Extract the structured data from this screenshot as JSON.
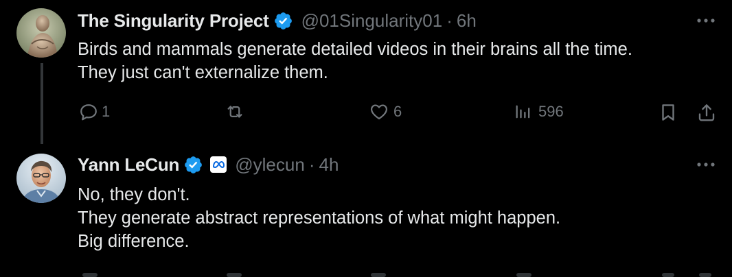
{
  "tweets": [
    {
      "author": {
        "name": "The Singularity Project",
        "handle": "@01Singularity01",
        "verified": true
      },
      "separator": "·",
      "time": "6h",
      "text_lines": [
        "Birds and mammals generate detailed videos in their brains all the time.",
        "They just can't externalize them."
      ],
      "actions": {
        "replies": "1",
        "retweets": "",
        "likes": "6",
        "views": "596"
      }
    },
    {
      "author": {
        "name": "Yann LeCun",
        "handle": "@ylecun",
        "verified": true,
        "affiliation_icon": "meta-logo-icon"
      },
      "separator": "·",
      "time": "4h",
      "text_lines": [
        "No, they don't.",
        "They generate abstract representations of what might happen.",
        "Big difference."
      ]
    }
  ],
  "colors": {
    "background": "#000000",
    "text": "#e7e9ea",
    "secondary": "#71767b",
    "verified": "#1d9bf0",
    "thread_line": "#333639",
    "meta_blue": "#0668e1"
  }
}
